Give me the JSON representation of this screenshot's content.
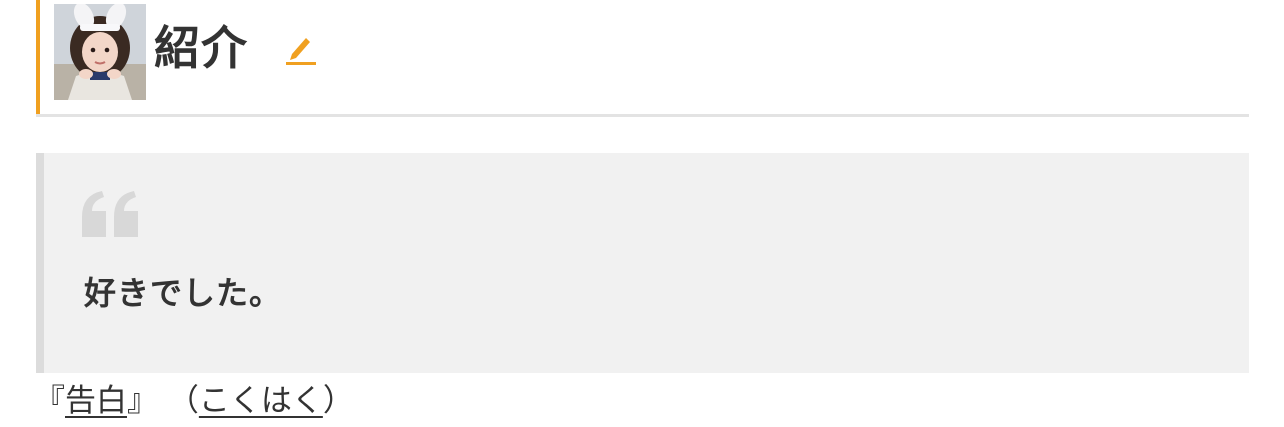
{
  "header": {
    "title": "紹介",
    "avatar_label": "profile-avatar",
    "edit_icon": "pencil-icon",
    "accent_color": "#f0a020"
  },
  "quote": {
    "icon": "quote-open-icon",
    "text": "好きでした。",
    "background": "#f1f1f1"
  },
  "reading": {
    "open_bracket": "『",
    "term": "告白",
    "close_bracket": "』",
    "open_paren": "（",
    "kana": "こくはく",
    "close_paren": "）"
  }
}
